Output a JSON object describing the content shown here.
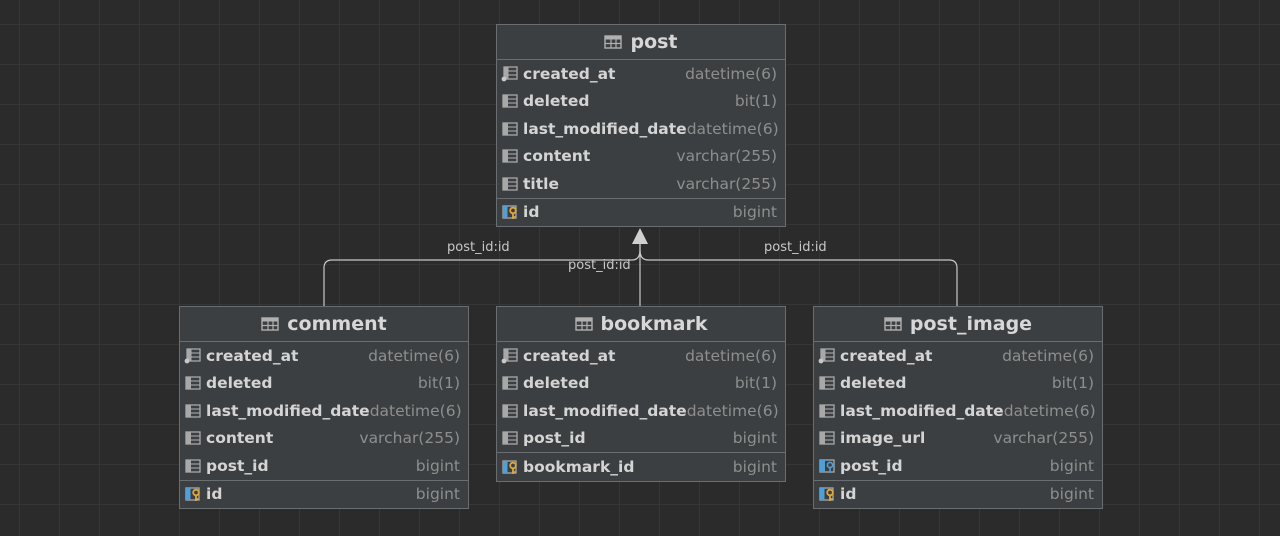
{
  "colors": {
    "background": "#2b2b2b",
    "grid": "#363636",
    "table_fill": "#3c3f41",
    "table_border": "#6b6e70",
    "connector": "#c8c8c8",
    "key_icon": "#e0a83a",
    "fk_icon": "#4f9fd8"
  },
  "tables": {
    "post": {
      "name": "post",
      "columns": [
        {
          "name": "created_at",
          "type": "datetime(6)"
        },
        {
          "name": "deleted",
          "type": "bit(1)"
        },
        {
          "name": "last_modified_date",
          "type": "datetime(6)"
        },
        {
          "name": "content",
          "type": "varchar(255)"
        },
        {
          "name": "title",
          "type": "varchar(255)"
        }
      ],
      "keys": [
        {
          "name": "id",
          "type": "bigint"
        }
      ]
    },
    "comment": {
      "name": "comment",
      "columns": [
        {
          "name": "created_at",
          "type": "datetime(6)"
        },
        {
          "name": "deleted",
          "type": "bit(1)"
        },
        {
          "name": "last_modified_date",
          "type": "datetime(6)"
        },
        {
          "name": "content",
          "type": "varchar(255)"
        },
        {
          "name": "post_id",
          "type": "bigint"
        }
      ],
      "keys": [
        {
          "name": "id",
          "type": "bigint"
        }
      ]
    },
    "bookmark": {
      "name": "bookmark",
      "columns": [
        {
          "name": "created_at",
          "type": "datetime(6)"
        },
        {
          "name": "deleted",
          "type": "bit(1)"
        },
        {
          "name": "last_modified_date",
          "type": "datetime(6)"
        },
        {
          "name": "post_id",
          "type": "bigint"
        }
      ],
      "keys": [
        {
          "name": "bookmark_id",
          "type": "bigint"
        }
      ]
    },
    "post_image": {
      "name": "post_image",
      "columns": [
        {
          "name": "created_at",
          "type": "datetime(6)"
        },
        {
          "name": "deleted",
          "type": "bit(1)"
        },
        {
          "name": "last_modified_date",
          "type": "datetime(6)"
        },
        {
          "name": "image_url",
          "type": "varchar(255)"
        },
        {
          "name": "post_id",
          "type": "bigint"
        }
      ],
      "keys": [
        {
          "name": "id",
          "type": "bigint"
        }
      ]
    }
  },
  "relations": {
    "comment_label": "post_id:id",
    "bookmark_label": "post_id:id",
    "post_image_label": "post_id:id"
  }
}
